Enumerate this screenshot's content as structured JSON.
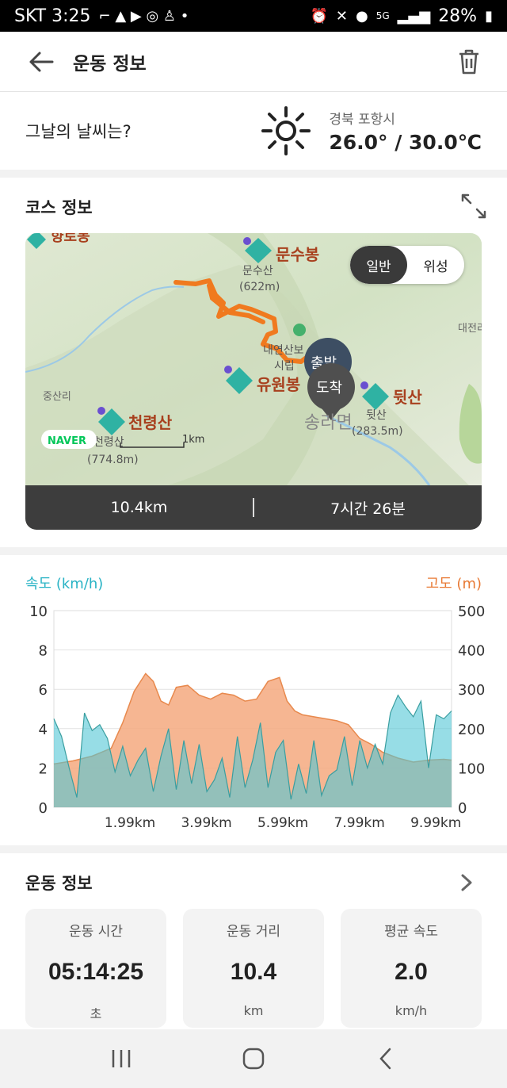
{
  "status_bar": {
    "carrier_time": "SKT 3:25",
    "battery": "28%",
    "network": "5G"
  },
  "app_bar": {
    "title": "운동 정보"
  },
  "weather": {
    "question": "그날의 날씨는?",
    "location": "경북 포항시",
    "temperature": "26.0° / 30.0℃"
  },
  "course": {
    "title": "코스 정보",
    "map_toggle": {
      "normal": "일반",
      "satellite": "위성"
    },
    "map_labels": {
      "peak_munsu": "문수봉",
      "peak_munsu_sub": "문수산",
      "peak_munsu_height": "(622m)",
      "peak_yuwon": "유원봉",
      "peak_dwit": "뒷산",
      "peak_dwit_sub": "뒷산",
      "peak_dwit_height": "(283.5m)",
      "peak_cheonryeong": "천령산",
      "peak_cheonryeong_sub": "천령산",
      "peak_cheonryeong_height": "(774.8m)",
      "town_songra": "송라면",
      "village_jungsan": "중산리",
      "village_daejeon": "대전리",
      "park": "내연산보",
      "park_sub": "시립",
      "start_marker": "출발",
      "end_marker": "도착",
      "scale": "1km",
      "naver_logo": "NAVER",
      "top_left_peak": "향로봉"
    },
    "distance": "10.4km",
    "duration": "7시간 26분"
  },
  "chart": {
    "legend_speed": "속도 (km/h)",
    "legend_altitude": "고도 (m)"
  },
  "chart_data": {
    "type": "area",
    "xlabel": "",
    "x_ticks": [
      "1.99km",
      "3.99km",
      "5.99km",
      "7.99km",
      "9.99km"
    ],
    "xlim": [
      0,
      10.4
    ],
    "series": [
      {
        "name": "속도 (km/h)",
        "axis": "left",
        "color": "#52c6d6",
        "ylim": [
          0,
          10
        ],
        "y_ticks": [
          "0",
          "2",
          "4",
          "6",
          "8",
          "10"
        ],
        "x": [
          0,
          0.2,
          0.4,
          0.6,
          0.8,
          1.0,
          1.2,
          1.4,
          1.6,
          1.8,
          2.0,
          2.2,
          2.4,
          2.6,
          2.8,
          3.0,
          3.2,
          3.4,
          3.6,
          3.8,
          4.0,
          4.2,
          4.4,
          4.6,
          4.8,
          5.0,
          5.2,
          5.4,
          5.6,
          5.8,
          6.0,
          6.2,
          6.4,
          6.6,
          6.8,
          7.0,
          7.2,
          7.4,
          7.6,
          7.8,
          8.0,
          8.2,
          8.4,
          8.6,
          8.8,
          9.0,
          9.2,
          9.4,
          9.6,
          9.8,
          10.0,
          10.2,
          10.4
        ],
        "values": [
          4.5,
          3.6,
          2.0,
          0.5,
          4.8,
          3.9,
          4.2,
          3.5,
          1.8,
          3.1,
          1.6,
          2.4,
          3.0,
          0.8,
          2.6,
          4.0,
          0.9,
          3.4,
          1.2,
          3.2,
          0.8,
          1.4,
          2.5,
          0.5,
          3.6,
          1.0,
          2.4,
          4.3,
          1.0,
          2.8,
          3.4,
          0.4,
          2.2,
          0.7,
          3.4,
          0.6,
          1.6,
          1.9,
          3.6,
          1.1,
          3.4,
          2.0,
          3.2,
          2.2,
          4.8,
          5.7,
          5.1,
          4.6,
          5.4,
          2.0,
          4.7,
          4.5,
          4.9
        ]
      },
      {
        "name": "고도 (m)",
        "axis": "right",
        "color": "#f5a97f",
        "ylim": [
          0,
          500
        ],
        "y_ticks": [
          "0",
          "100",
          "200",
          "300",
          "400",
          "500"
        ],
        "x": [
          0,
          0.5,
          1.0,
          1.5,
          1.8,
          2.1,
          2.4,
          2.6,
          2.8,
          3.0,
          3.2,
          3.5,
          3.8,
          4.1,
          4.4,
          4.7,
          5.0,
          5.3,
          5.6,
          5.9,
          6.1,
          6.3,
          6.5,
          6.8,
          7.1,
          7.4,
          7.7,
          8.0,
          8.3,
          8.6,
          9.0,
          9.4,
          9.8,
          10.2,
          10.4
        ],
        "values": [
          110,
          118,
          130,
          150,
          215,
          295,
          340,
          320,
          270,
          260,
          305,
          310,
          285,
          275,
          290,
          285,
          270,
          275,
          320,
          330,
          270,
          245,
          235,
          230,
          225,
          220,
          210,
          175,
          160,
          140,
          125,
          115,
          120,
          122,
          120
        ]
      }
    ]
  },
  "workout": {
    "title": "운동 정보",
    "stats": [
      {
        "label": "운동 시간",
        "value": "05:14:25",
        "unit": "초"
      },
      {
        "label": "운동 거리",
        "value": "10.4",
        "unit": "km"
      },
      {
        "label": "평균 속도",
        "value": "2.0",
        "unit": "km/h"
      }
    ]
  },
  "colors": {
    "route": "#f07a1f",
    "speed": "#52c6d6",
    "altitude": "#f5a97f",
    "peak_marker": "#2fb2a3",
    "peak_label": "#a8401e"
  }
}
